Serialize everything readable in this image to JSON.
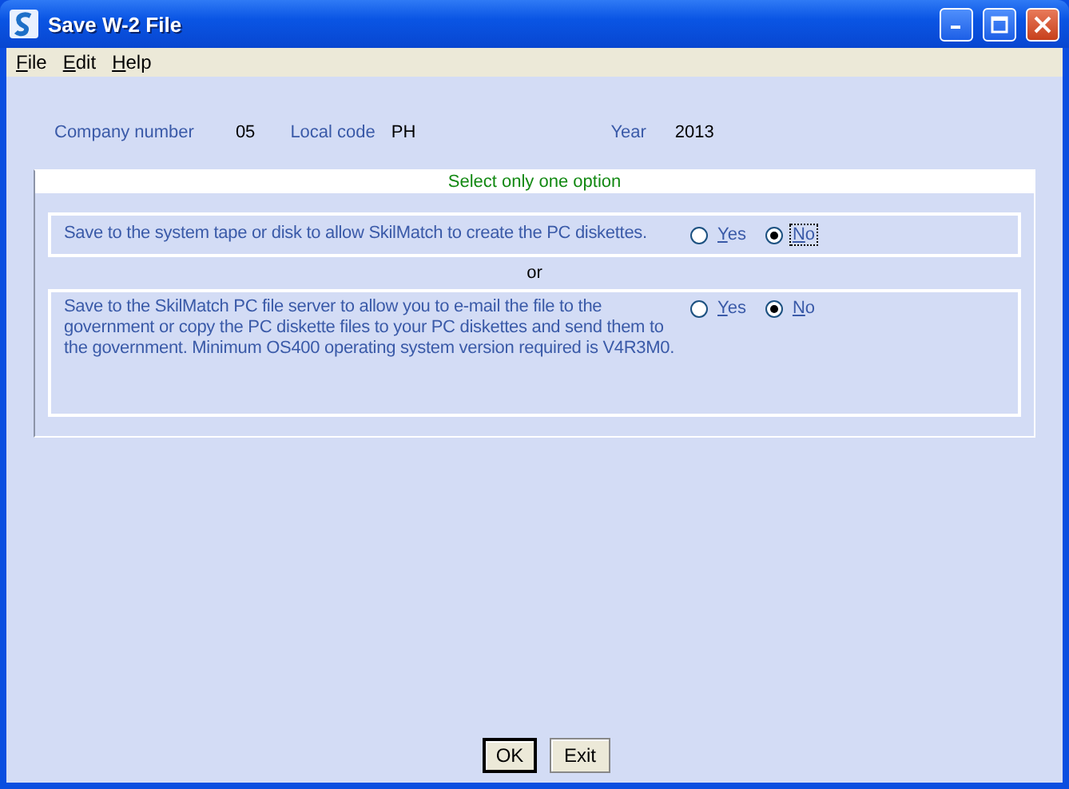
{
  "window": {
    "title": "Save W-2 File"
  },
  "menu": [
    {
      "label": "File"
    },
    {
      "label": "Edit"
    },
    {
      "label": "Help"
    }
  ],
  "header": {
    "company_label": "Company number",
    "company_value": "05",
    "local_label": "Local code",
    "local_value": "PH",
    "year_label": "Year",
    "year_value": "2013"
  },
  "panel": {
    "title": "Select only one option",
    "separator": "or",
    "options": [
      {
        "text": "Save to the system tape or disk to allow SkilMatch to create the PC diskettes.",
        "choices": [
          {
            "label": "Yes",
            "selected": false,
            "focused": false
          },
          {
            "label": "No",
            "selected": true,
            "focused": true
          }
        ]
      },
      {
        "text": "Save to the SkilMatch PC file server to allow you to e-mail the file to the government or copy the PC diskette files to your PC diskettes and send them to the government.  Minimum OS400 operating system version required is V4R3M0.",
        "choices": [
          {
            "label": "Yes",
            "selected": false,
            "focused": false
          },
          {
            "label": "No",
            "selected": true,
            "focused": false
          }
        ]
      }
    ]
  },
  "buttons": [
    {
      "label": "OK",
      "default": true
    },
    {
      "label": "Exit",
      "default": false
    }
  ]
}
